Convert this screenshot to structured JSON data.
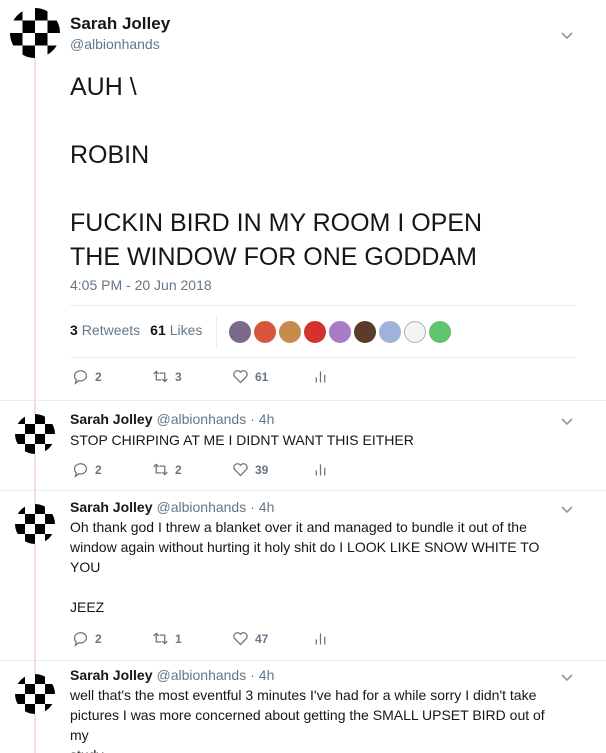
{
  "main_tweet": {
    "name": "Sarah Jolley",
    "handle": "@albionhands",
    "text": "AUH \\\n\nROBIN\n\nFUCKIN BIRD IN MY ROOM I OPEN\nTHE WINDOW FOR ONE GODDAM",
    "time": "4:05 PM - 20 Jun 2018",
    "retweets_count": "3",
    "retweets_label": "Retweets",
    "likes_count": "61",
    "likes_label": "Likes",
    "liker_colors": [
      "#7a6a88",
      "#d8563a",
      "#c98b4c",
      "#d5322e",
      "#a77cc6",
      "#5a3c2a",
      "#9fb3d8",
      "#f4f4f4",
      "#5fc46b"
    ],
    "actions": {
      "replies": "2",
      "retweets": "3",
      "likes": "61"
    }
  },
  "replies": [
    {
      "name": "Sarah Jolley",
      "handle": "@albionhands",
      "time": "· 4h",
      "text": "STOP CHIRPING AT ME I DIDNT WANT THIS EITHER",
      "actions": {
        "replies": "2",
        "retweets": "2",
        "likes": "39"
      }
    },
    {
      "name": "Sarah Jolley",
      "handle": "@albionhands",
      "time": "· 4h",
      "text": "Oh thank god I threw a blanket over it and managed to bundle it out of the\nwindow again without hurting it holy shit do I LOOK LIKE SNOW WHITE TO\nYOU\n\nJEEZ",
      "actions": {
        "replies": "2",
        "retweets": "1",
        "likes": "47"
      }
    },
    {
      "name": "Sarah Jolley",
      "handle": "@albionhands",
      "time": "· 4h",
      "text": "well that's the most eventful 3 minutes I've had for a while sorry I didn't take\npictures I was more concerned about getting the SMALL UPSET BIRD out of my\nstudy"
    }
  ],
  "colors": {
    "thread_line": "#f5dde0",
    "secondary": "#657786",
    "divider": "#e6ecf0"
  }
}
